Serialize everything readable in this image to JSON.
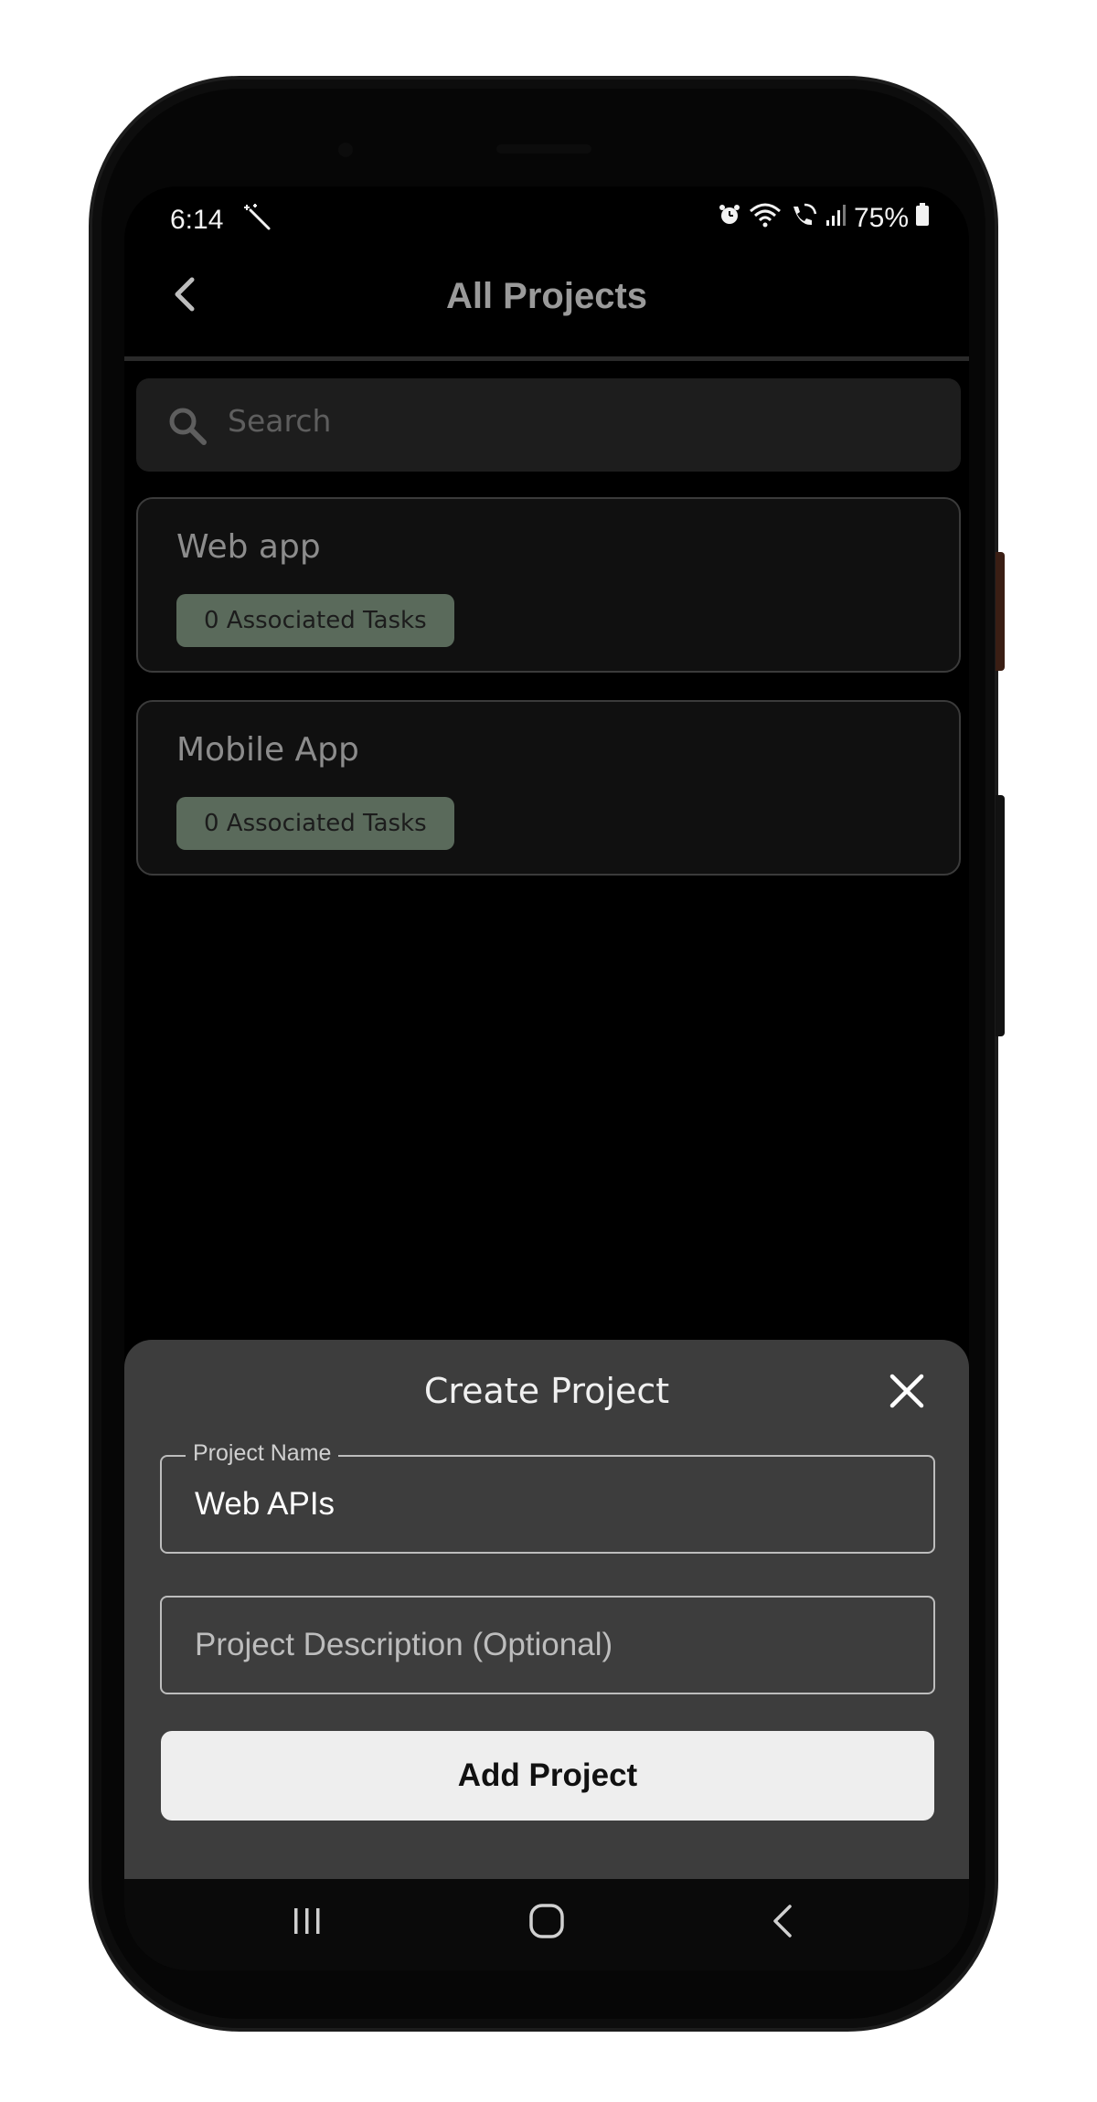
{
  "status_bar": {
    "time": "6:14",
    "battery": "75%",
    "icons": [
      "magic-wand-icon",
      "alarm-icon",
      "wifi-icon",
      "wifi-calling-icon",
      "signal-icon",
      "battery-icon"
    ]
  },
  "header": {
    "title": "All Projects",
    "back_icon": "chevron-left-icon"
  },
  "search": {
    "placeholder": "Search",
    "icon": "search-icon"
  },
  "projects": [
    {
      "name": "Web app",
      "badge": "0 Associated Tasks"
    },
    {
      "name": "Mobile App",
      "badge": "0 Associated Tasks"
    }
  ],
  "sheet": {
    "title": "Create Project",
    "close_icon": "close-icon",
    "project_name_label": "Project Name",
    "project_name_value": "Web APIs",
    "project_description_placeholder": "Project Description (Optional)",
    "add_button_label": "Add Project"
  },
  "nav": {
    "items": [
      "recents-icon",
      "home-icon",
      "back-icon"
    ]
  },
  "colors": {
    "background": "#000000",
    "sheet": "#3d3d3d",
    "badge": "#5a6a5b",
    "button": "#eeeeee"
  }
}
